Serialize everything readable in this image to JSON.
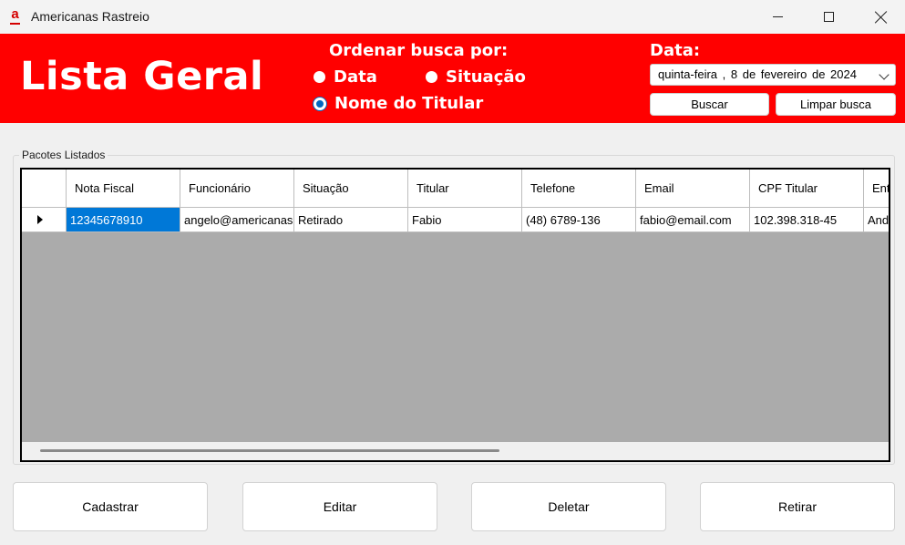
{
  "window": {
    "title": "Americanas Rastreio",
    "icon_glyph": "a",
    "controls": [
      "minimize-icon",
      "maximize-icon",
      "close-icon"
    ]
  },
  "header": {
    "title": "Lista Geral",
    "sort_label": "Ordenar busca por:",
    "sort_options": [
      {
        "label": "Data",
        "checked": false
      },
      {
        "label": "Situação",
        "checked": false
      },
      {
        "label": "Nome do Titular",
        "checked": true
      }
    ],
    "date_label": "Data:",
    "date_value": "quinta-feira ,  8 de fevereiro de 2024",
    "buscar_label": "Buscar",
    "limpar_label": "Limpar busca",
    "background_color": "#ff0000"
  },
  "group": {
    "label": "Pacotes Listados"
  },
  "grid": {
    "columns": [
      "",
      "Nota Fiscal",
      "Funcionário",
      "Situação",
      "Titular",
      "Telefone",
      "Email",
      "CPF Titular",
      "Entrega"
    ],
    "rows": [
      [
        "",
        "12345678910",
        "angelo@americanas.com",
        "Retirado",
        "Fabio",
        "(48)  6789-136",
        "fabio@email.com",
        "102.398.318-45",
        "Andamento"
      ]
    ],
    "selected_cell": {
      "row": 0,
      "col": 1
    },
    "selection_color": "#0078d7"
  },
  "actions": {
    "cadastrar": "Cadastrar",
    "editar": "Editar",
    "deletar": "Deletar",
    "retirar": "Retirar"
  }
}
